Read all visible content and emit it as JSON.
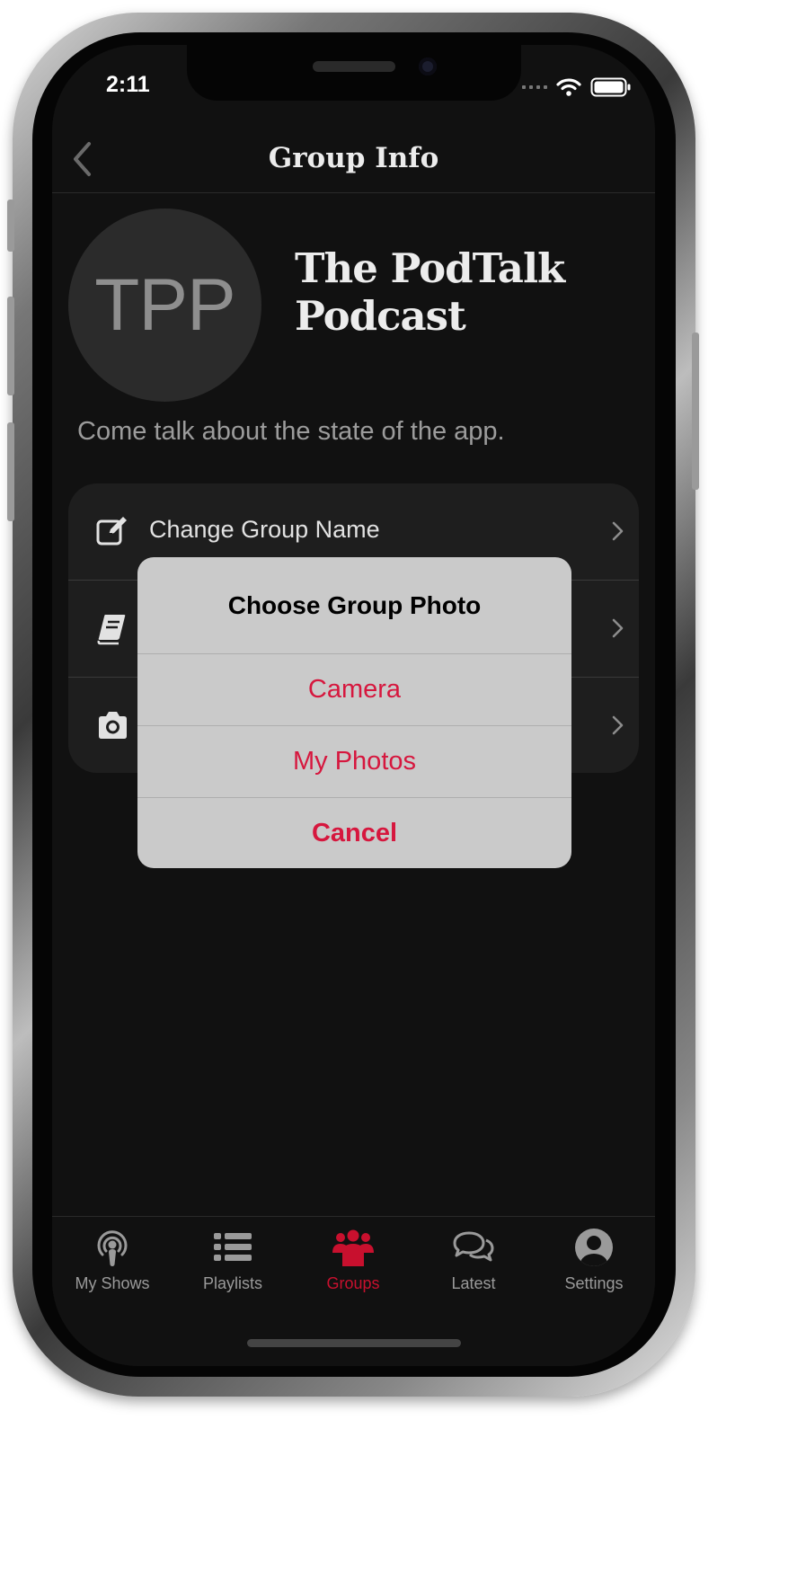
{
  "status": {
    "time": "2:11"
  },
  "nav": {
    "title": "Group Info"
  },
  "group": {
    "avatar_initials": "TPP",
    "name_line1": "The PodTalk",
    "name_line2": "Podcast",
    "description": "Come talk about the state of the app."
  },
  "menu": {
    "items": [
      {
        "label": "Change Group Name",
        "icon": "edit-icon"
      },
      {
        "label": "",
        "icon": "book-icon"
      },
      {
        "label": "",
        "icon": "camera-icon"
      }
    ]
  },
  "alert": {
    "title": "Choose Group Photo",
    "camera": "Camera",
    "my_photos": "My Photos",
    "cancel": "Cancel"
  },
  "tabs": [
    {
      "label": "My Shows",
      "icon": "podcast-icon",
      "active": false
    },
    {
      "label": "Playlists",
      "icon": "list-icon",
      "active": false
    },
    {
      "label": "Groups",
      "icon": "group-icon",
      "active": true
    },
    {
      "label": "Latest",
      "icon": "chat-icon",
      "active": false
    },
    {
      "label": "Settings",
      "icon": "user-circle-icon",
      "active": false
    }
  ],
  "colors": {
    "accent": "#c8102e",
    "alert_action": "#d6173e",
    "screen_bg": "#111111",
    "card_bg": "#1e1e1e",
    "alert_bg": "#cacaca"
  }
}
